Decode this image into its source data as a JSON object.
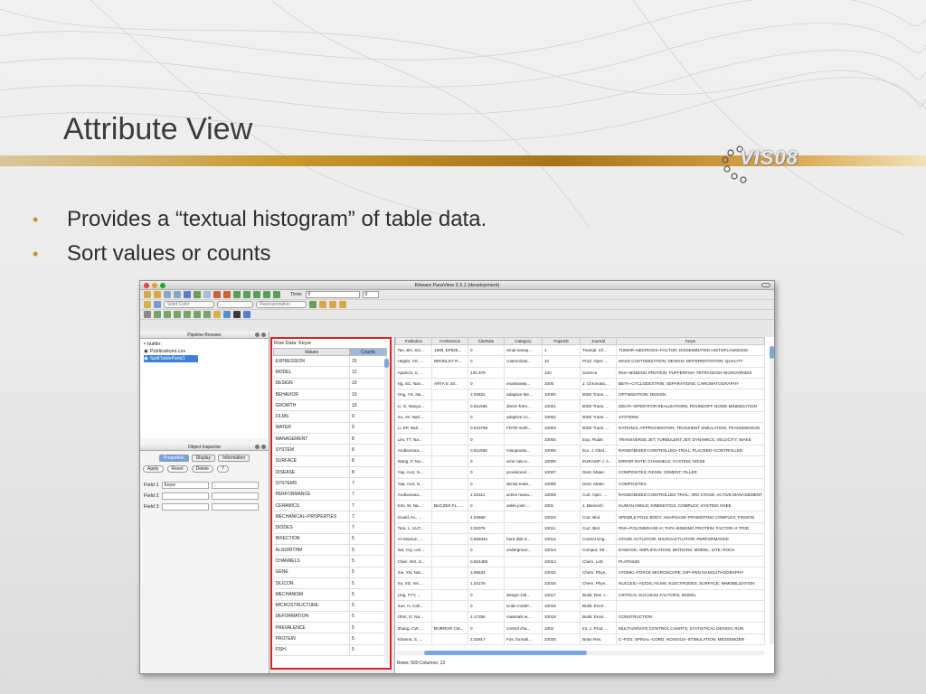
{
  "slide": {
    "title": "Attribute View",
    "logo_text": "VIS08",
    "bullets": [
      "Provides a “textual histogram” of table data.",
      "Sort values or counts"
    ]
  },
  "colors": {
    "accent": "#c8922a",
    "highlight_border": "#dd2222",
    "selection": "#3f7fd6"
  },
  "app": {
    "window_title": "Kitware ParaView 3.3.1 (development)",
    "time_label": "Time:",
    "time_value": "0",
    "time_step": "0",
    "color_combo": "Solid Color",
    "representation_combo": "Representation",
    "pipeline_browser": {
      "title": "Pipeline Browser",
      "items": [
        "builtin:",
        "Publications.csv",
        "SplitTableField1"
      ]
    },
    "object_inspector": {
      "title": "Object Inspector",
      "tabs": [
        "Properties",
        "Display",
        "Information"
      ],
      "buttons": [
        "Apply",
        "Reset",
        "Delete",
        "?"
      ],
      "fields": [
        {
          "label": "Field 1",
          "value": "Keyw",
          "delimiter": ";"
        },
        {
          "label": "Field 2",
          "value": "",
          "delimiter": ""
        },
        {
          "label": "Field 3",
          "value": "",
          "delimiter": ""
        }
      ]
    },
    "histogram": {
      "row_data_label": "Row Data:",
      "row_data_value": "Keyw",
      "columns": [
        "Values",
        "Counts"
      ],
      "rows": [
        [
          "EXPRESSION",
          "15"
        ],
        [
          "MODEL",
          "12"
        ],
        [
          "DESIGN",
          "10"
        ],
        [
          "BEHAVIOR",
          "10"
        ],
        [
          "GROWTH",
          "10"
        ],
        [
          "FILMS",
          "9"
        ],
        [
          "WATER",
          "9"
        ],
        [
          "MANAGEMENT",
          "8"
        ],
        [
          "SYSTEM",
          "8"
        ],
        [
          "SURFACE",
          "8"
        ],
        [
          "DISEASE",
          "8"
        ],
        [
          "SYSTEMS",
          "7"
        ],
        [
          "PERFORMANCE",
          "7"
        ],
        [
          "CERAMICS",
          "7"
        ],
        [
          "MECHANICAL–PROPERTIES",
          "7"
        ],
        [
          "DIODES",
          "7"
        ],
        [
          "INFECTION",
          "5"
        ],
        [
          "ALGORITHM",
          "5"
        ],
        [
          "CHANNELS",
          "5"
        ],
        [
          "GENE",
          "5"
        ],
        [
          "SILICON",
          "5"
        ],
        [
          "MECHANISM",
          "5"
        ],
        [
          "MICROSTRUCTURE",
          "5"
        ],
        [
          "DEFORMATION",
          "5"
        ],
        [
          "PREVALENCE",
          "5"
        ],
        [
          "PROTEIN",
          "5"
        ],
        [
          "FISH",
          "5"
        ]
      ]
    },
    "table": {
      "columns": [
        "Institution",
        "Conference",
        "CiteRate",
        "Category",
        "PaperID",
        "Journal",
        "Keyw"
      ],
      "rows": [
        [
          "Tan, BH, Sin...",
          "1999, EPIDE...",
          "0",
          "renal transp...",
          "1",
          "Transpl. Inf...",
          "TUMOR–NECROSIS–FACTOR; DISSEMINATED HISTOPLASMOSIS"
        ],
        [
          "Hegde, VG, ...",
          "BRODLEY R...",
          "0",
          "customizati...",
          "10",
          "Prod. Oper. ...",
          "MASS CUSTOMIZATION; DESIGN; DIFFERENTIATION; QUALITY"
        ],
        [
          "Aparicio, S, ...",
          "",
          "126.379",
          "",
          "100",
          "Science",
          "RNA–BINDING PROTEIN; PUFFERFISH TETRAODON NIGROVIRIDIS"
        ],
        [
          "Ng, SC, Nan...",
          "ARTA 5, 20...",
          "0",
          "enantiosep...",
          "1000",
          "J. Chromato...",
          "BETA–CYCLODEXTRIN; SEPARATIONS; CHROMATOGRAPHY"
        ],
        [
          "Ong, YS, Na...",
          "",
          "2.04622",
          "adaptive Me...",
          "10000",
          "IEEE Trans. ...",
          "OPTIMIZATION; DESIGN"
        ],
        [
          "Li, G, Nanya...",
          "",
          "0.511555",
          "direct–form...",
          "10001",
          "IEEE Trans. ...",
          "DELTA–OPERATOR REALIZATIONS; ROUNDOFF NOISE MINIMIZATION"
        ],
        [
          "Xu, JX, Natl ...",
          "",
          "0",
          "adaptive co...",
          "10002",
          "IEEE Trans. ...",
          "SYSTEMS"
        ],
        [
          "Li, EP, Natl ...",
          "",
          "0.943798",
          "FDTD meth...",
          "10003",
          "IEEE Trans. ...",
          "RATIONAL APPROXIMATION; TRANSIENT SIMULATION; TRANSMISSION"
        ],
        [
          "Lim, TT, Na...",
          "",
          "0",
          "",
          "10004",
          "Exp. Fluids",
          "TRANSVERSE JET; TURBULENT JET; DYNAMICS; VELOCITY; WAKE"
        ],
        [
          "Arulkumara...",
          "",
          "0.511555",
          "misoprosto...",
          "10005",
          "Eur. J. Obst...",
          "RANDOMIZED CONTROLLED–TRIAL; PLACEBO–CONTROLLED"
        ],
        [
          "Wang, P, Na...",
          "",
          "0",
          "error rate e...",
          "10006",
          "EURASIP J. A...",
          "ERROR RATE; CHANNELS; SYSTEM; NOISE"
        ],
        [
          "Yap, AUJ, N...",
          "",
          "0",
          "provisional ...",
          "10007",
          "Dent. Mater.",
          "COMPOSITES; RESIN; CEMENT; FILLER"
        ],
        [
          "Yap, AUJ, N...",
          "",
          "0",
          "dental mate...",
          "10008",
          "Dent. Mater.",
          "COMPOSITES"
        ],
        [
          "Arulkumara...",
          "",
          "1.02311",
          "active mana...",
          "10009",
          "Curr. Opin. ...",
          "RANDOMIZED CONTROLLED TRIAL; 3RD STAGE; ACTIVE MANAGEMENT"
        ],
        [
          "Kim, W, Na...",
          "BUCZEK FL, ...",
          "0",
          "ankle joint ...",
          "1001",
          "J. Biomech.",
          "HUMAN ANKLE; KINEMATICS; COMPLEX; SYSTEM; KNEE"
        ],
        [
          "Gould, KL, ...",
          "",
          "4.54668",
          "",
          "10010",
          "Curr. Biol.",
          "SPINDLE POLE BODY; ANAPHASE–PROMOTING COMPLEX; FISSION"
        ],
        [
          "Tora, L, ULP...",
          "",
          "2.02075",
          "",
          "10011",
          "Curr. Biol.",
          "RNA–POLYMERASE–II; TATA–BINDING PROTEIN; FACTOR–2 TFIID"
        ],
        [
          "Al–Mamun, ...",
          "",
          "0.559342",
          "hard disk d...",
          "10012",
          "Control Eng...",
          "STAGE ACTUATOR; MICROACTUATOR; PERFORMANCE"
        ],
        [
          "Wu, CQ, Uni...",
          "",
          "0",
          "undergroun...",
          "10013",
          "Comput. Str...",
          "DAMAGE; AMPLIFICATION; MOTIONS; MODEL; SITE; ROCK"
        ],
        [
          "Chen, WX, Z...",
          "",
          "0.504489",
          "",
          "10014",
          "Chem. Lett.",
          "PLATINUM"
        ],
        [
          "Xie, XN, Nat...",
          "",
          "3.09534",
          "",
          "10015",
          "Chem. Phys...",
          "ATOMIC–FORCE MICROSCOPE; DIP–PEN NANOLITHOGRAPHY"
        ],
        [
          "Su, XD, Ins ...",
          "",
          "1.03178",
          "",
          "10016",
          "Chem. Phys...",
          "NUCLEIC–ACIDS; FILMS; ELECTRODES; SURFACE; IMMOBILIZATION"
        ],
        [
          "Ling, FYY, ...",
          "",
          "0",
          "design–bid...",
          "10017",
          "Build. Res. I...",
          "CRITICAL SUCCESS FACTORS; MODEL"
        ],
        [
          "Xue, H, Cali...",
          "",
          "0",
          "scale model...",
          "10018",
          "Build. Envir...",
          ""
        ],
        [
          "Ofori, G, Na...",
          "",
          "1.17255",
          "materials w...",
          "10019",
          "Build. Envir...",
          "CONSTRUCTION"
        ],
        [
          "Zhang, CW, ...",
          "BORROR CM...",
          "0",
          "control cha...",
          "1002",
          "Int. J. Prod. ...",
          "MULTIVARIATE CONTROL CHARTS; STATISTICAL DESIGN; RUN"
        ],
        [
          "Khanna, S, ...",
          "",
          "2.02917",
          "Fos, formali...",
          "10020",
          "Brain Res.",
          "C–FOS; SPINAL–CORD; NOXIOUS–STIMULATION; MESSENGER"
        ]
      ],
      "status": "Rows: 500  Columns: 13"
    }
  }
}
